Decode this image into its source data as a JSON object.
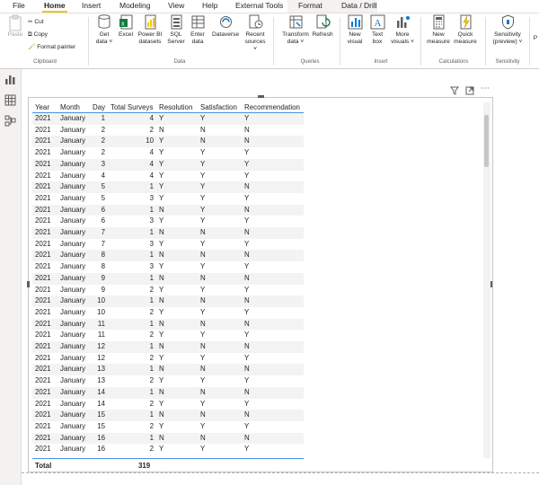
{
  "menu": {
    "items": [
      "File",
      "Home",
      "Insert",
      "Modeling",
      "View",
      "Help",
      "External Tools",
      "Format",
      "Data / Drill"
    ],
    "active": "Home"
  },
  "ribbon": {
    "clipboard": {
      "paste": "Paste",
      "cut": "Cut",
      "copy": "Copy",
      "format_painter": "Format painter",
      "group": "Clipboard"
    },
    "data": {
      "get_data": [
        "Get",
        "data ˅"
      ],
      "excel": "Excel",
      "power_bi": [
        "Power BI",
        "datasets"
      ],
      "sql": [
        "SQL",
        "Server"
      ],
      "enter": [
        "Enter",
        "data"
      ],
      "dataverse": "Dataverse",
      "recent": [
        "Recent",
        "sources ˅"
      ],
      "group": "Data"
    },
    "queries": {
      "transform": [
        "Transform",
        "data ˅"
      ],
      "refresh": "Refresh",
      "group": "Queries"
    },
    "insert": {
      "new_visual": [
        "New",
        "visual"
      ],
      "text_box": [
        "Text",
        "box"
      ],
      "more": [
        "More",
        "visuals ˅"
      ],
      "group": "Insert"
    },
    "calculations": {
      "new_measure": [
        "New",
        "measure"
      ],
      "quick_measure": [
        "Quick",
        "measure"
      ],
      "group": "Calculations"
    },
    "sensitivity": {
      "label": [
        "Sensitivity",
        "(preview) ˅"
      ],
      "group": "Sensitivity"
    },
    "share_cut": "P"
  },
  "table": {
    "columns": [
      "Year",
      "Month",
      "Day",
      "Total Surveys",
      "Resolution",
      "Satisfaction",
      "Recommendation"
    ],
    "rows": [
      [
        "2021",
        "January",
        "1",
        "4",
        "Y",
        "Y",
        "Y"
      ],
      [
        "2021",
        "January",
        "2",
        "2",
        "N",
        "N",
        "N"
      ],
      [
        "2021",
        "January",
        "2",
        "10",
        "Y",
        "N",
        "N"
      ],
      [
        "2021",
        "January",
        "2",
        "4",
        "Y",
        "Y",
        "Y"
      ],
      [
        "2021",
        "January",
        "3",
        "4",
        "Y",
        "Y",
        "Y"
      ],
      [
        "2021",
        "January",
        "4",
        "4",
        "Y",
        "Y",
        "Y"
      ],
      [
        "2021",
        "January",
        "5",
        "1",
        "Y",
        "Y",
        "N"
      ],
      [
        "2021",
        "January",
        "5",
        "3",
        "Y",
        "Y",
        "Y"
      ],
      [
        "2021",
        "January",
        "6",
        "1",
        "N",
        "Y",
        "N"
      ],
      [
        "2021",
        "January",
        "6",
        "3",
        "Y",
        "Y",
        "Y"
      ],
      [
        "2021",
        "January",
        "7",
        "1",
        "N",
        "N",
        "N"
      ],
      [
        "2021",
        "January",
        "7",
        "3",
        "Y",
        "Y",
        "Y"
      ],
      [
        "2021",
        "January",
        "8",
        "1",
        "N",
        "N",
        "N"
      ],
      [
        "2021",
        "January",
        "8",
        "3",
        "Y",
        "Y",
        "Y"
      ],
      [
        "2021",
        "January",
        "9",
        "1",
        "N",
        "N",
        "N"
      ],
      [
        "2021",
        "January",
        "9",
        "2",
        "Y",
        "Y",
        "Y"
      ],
      [
        "2021",
        "January",
        "10",
        "1",
        "N",
        "N",
        "N"
      ],
      [
        "2021",
        "January",
        "10",
        "2",
        "Y",
        "Y",
        "Y"
      ],
      [
        "2021",
        "January",
        "11",
        "1",
        "N",
        "N",
        "N"
      ],
      [
        "2021",
        "January",
        "11",
        "2",
        "Y",
        "Y",
        "Y"
      ],
      [
        "2021",
        "January",
        "12",
        "1",
        "N",
        "N",
        "N"
      ],
      [
        "2021",
        "January",
        "12",
        "2",
        "Y",
        "Y",
        "Y"
      ],
      [
        "2021",
        "January",
        "13",
        "1",
        "N",
        "N",
        "N"
      ],
      [
        "2021",
        "January",
        "13",
        "2",
        "Y",
        "Y",
        "Y"
      ],
      [
        "2021",
        "January",
        "14",
        "1",
        "N",
        "N",
        "N"
      ],
      [
        "2021",
        "January",
        "14",
        "2",
        "Y",
        "Y",
        "Y"
      ],
      [
        "2021",
        "January",
        "15",
        "1",
        "N",
        "N",
        "N"
      ],
      [
        "2021",
        "January",
        "15",
        "2",
        "Y",
        "Y",
        "Y"
      ],
      [
        "2021",
        "January",
        "16",
        "1",
        "N",
        "N",
        "N"
      ],
      [
        "2021",
        "January",
        "16",
        "2",
        "Y",
        "Y",
        "Y"
      ]
    ],
    "total_label": "Total",
    "total_surveys": "319"
  },
  "colors": {
    "accent": "#f2c811",
    "header_rule": "#4a90e2"
  }
}
